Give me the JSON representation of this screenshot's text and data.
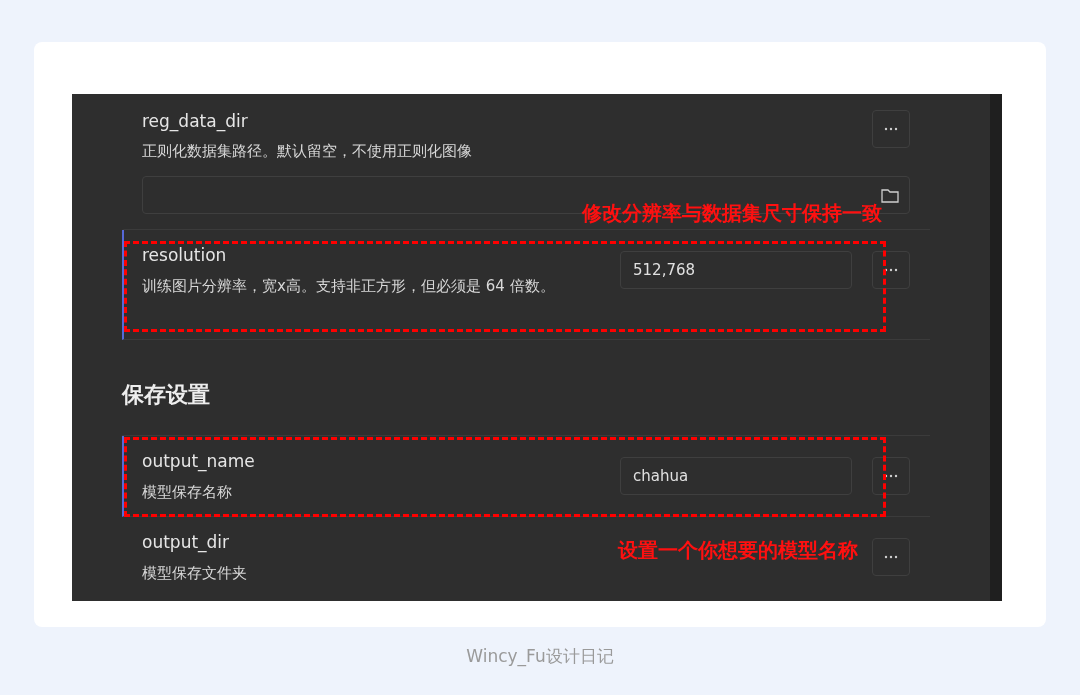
{
  "settings": [
    {
      "kind": "path",
      "name": "reg_data_dir",
      "description": "正则化数据集路径。默认留空，不使用正则化图像",
      "highlighted": false
    },
    {
      "kind": "text",
      "name": "resolution",
      "description": "训练图片分辨率，宽x高。支持非正方形，但必须是 64 倍数。",
      "value": "512,768",
      "highlighted": true,
      "annotation": {
        "text": "修改分辨率与数据集尺寸保持一致",
        "kind": "above"
      }
    },
    {
      "kind": "heading",
      "title": "保存设置"
    },
    {
      "kind": "text",
      "name": "output_name",
      "description": "模型保存名称",
      "value": "chahua",
      "highlighted": true,
      "annotation": {
        "text": "设置一个你想要的模型名称",
        "kind": "below"
      }
    },
    {
      "kind": "option",
      "name": "output_dir",
      "description": "模型保存文件夹",
      "highlighted": false
    }
  ],
  "caption": "Wincy_Fu设计日记"
}
